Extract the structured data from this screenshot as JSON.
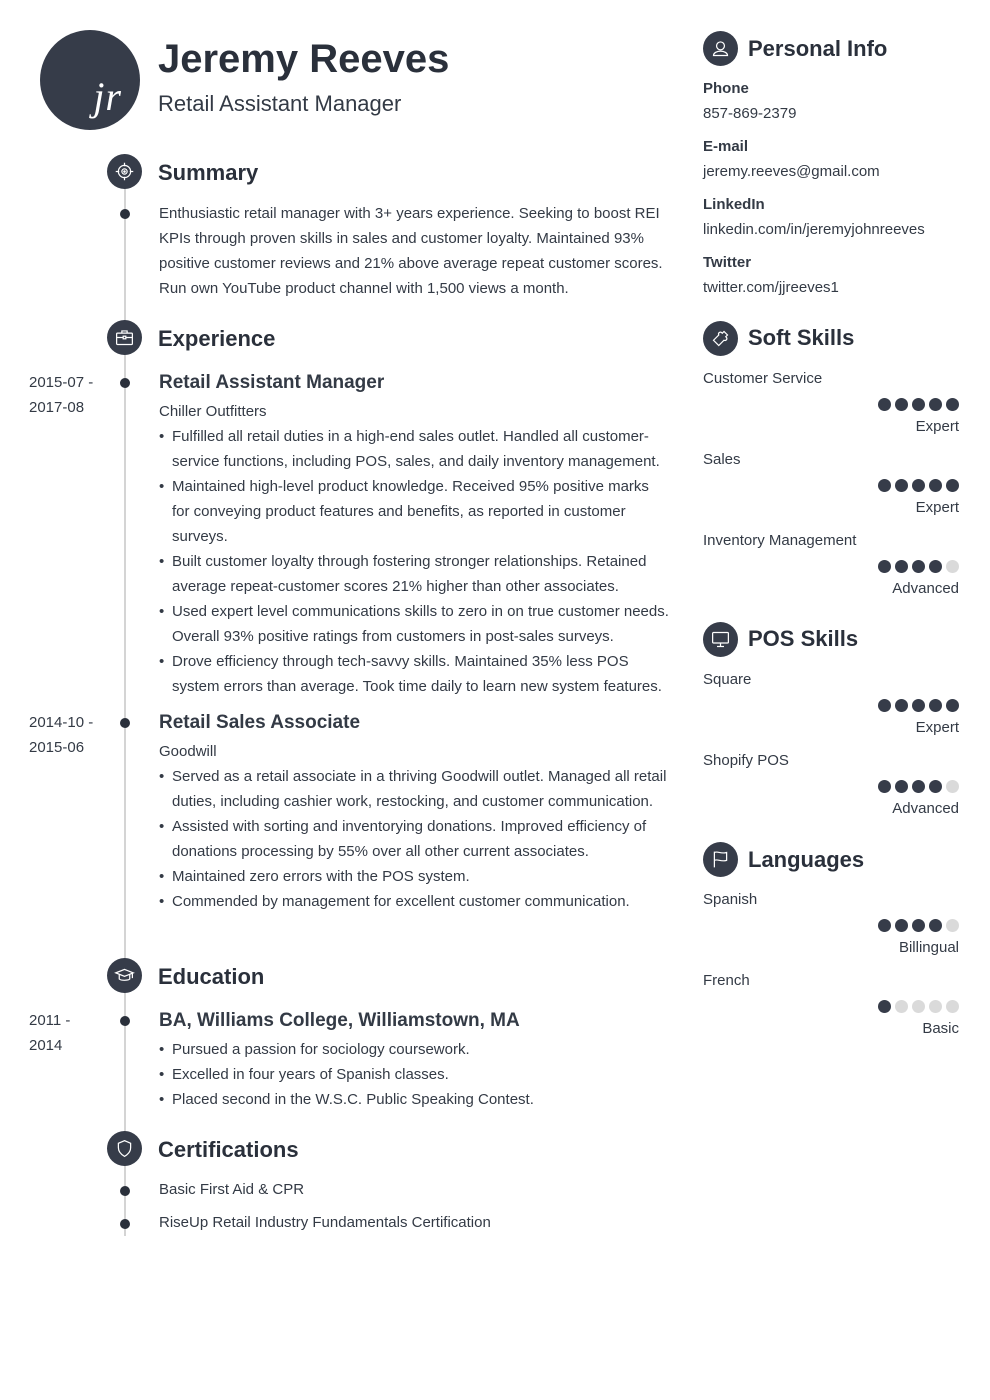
{
  "header": {
    "initials": "jr",
    "name": "Jeremy Reeves",
    "title": "Retail Assistant Manager"
  },
  "summary": {
    "heading": "Summary",
    "icon": "target-icon",
    "text": "Enthusiastic retail manager with 3+ years experience. Seeking to boost REI KPIs through proven skills in sales and customer loyalty. Maintained 93% positive customer reviews and 21% above average repeat customer scores. Run own YouTube product channel with 1,500 views a month."
  },
  "experience": {
    "heading": "Experience",
    "icon": "briefcase-icon",
    "jobs": [
      {
        "date_start": "2015-07 -",
        "date_end": "2017-08",
        "title": "Retail Assistant Manager",
        "company": "Chiller Outfitters",
        "bullets": [
          "Fulfilled all retail duties in a high-end sales outlet. Handled all customer-service functions, including POS, sales, and daily inventory management.",
          "Maintained high-level product knowledge. Received 95% positive marks for conveying product features and benefits, as reported in customer surveys.",
          "Built customer loyalty through fostering stronger relationships. Retained average repeat-customer scores 21% higher than other associates.",
          "Used expert level communications skills to zero in on true customer needs. Overall 93% positive ratings from customers in post-sales surveys.",
          "Drove efficiency through tech-savvy skills. Maintained 35% less POS system errors than average. Took time daily to learn new system features."
        ]
      },
      {
        "date_start": "2014-10 -",
        "date_end": "2015-06",
        "title": "Retail Sales Associate",
        "company": "Goodwill",
        "bullets": [
          "Served as a retail associate in a thriving Goodwill outlet. Managed all retail duties, including cashier work, restocking, and customer communication.",
          "Assisted with sorting and inventorying donations. Improved efficiency of donations processing by 55% over all other current associates.",
          "Maintained zero errors with the POS system.",
          "Commended by management for excellent customer communication."
        ]
      }
    ]
  },
  "education": {
    "heading": "Education",
    "icon": "graduation-cap-icon",
    "entries": [
      {
        "date_start": "2011 -",
        "date_end": "2014",
        "degree": "BA, Williams College, Williamstown, MA",
        "bullets": [
          "Pursued a passion for sociology coursework.",
          "Excelled in four years of Spanish classes.",
          "Placed second in the W.S.C. Public Speaking Contest."
        ]
      }
    ]
  },
  "certifications": {
    "heading": "Certifications",
    "icon": "shield-icon",
    "items": [
      "Basic First Aid & CPR",
      "RiseUp Retail Industry Fundamentals Certification"
    ]
  },
  "personal_info": {
    "heading": "Personal Info",
    "icon": "user-icon",
    "fields": [
      {
        "label": "Phone",
        "value": "857-869-2379"
      },
      {
        "label": "E-mail",
        "value": "jeremy.reeves@gmail.com"
      },
      {
        "label": "LinkedIn",
        "value": "linkedin.com/in/jeremyjohnreeves"
      },
      {
        "label": "Twitter",
        "value": "twitter.com/jjreeves1"
      }
    ]
  },
  "soft_skills": {
    "heading": "Soft Skills",
    "icon": "puzzle-icon",
    "items": [
      {
        "name": "Customer Service",
        "rating": 5,
        "max": 5,
        "level": "Expert"
      },
      {
        "name": "Sales",
        "rating": 5,
        "max": 5,
        "level": "Expert"
      },
      {
        "name": "Inventory Management",
        "rating": 4,
        "max": 5,
        "level": "Advanced"
      }
    ]
  },
  "pos_skills": {
    "heading": "POS Skills",
    "icon": "monitor-icon",
    "items": [
      {
        "name": "Square",
        "rating": 5,
        "max": 5,
        "level": "Expert"
      },
      {
        "name": "Shopify POS",
        "rating": 4,
        "max": 5,
        "level": "Advanced"
      }
    ]
  },
  "languages": {
    "heading": "Languages",
    "icon": "flag-icon",
    "items": [
      {
        "name": "Spanish",
        "rating": 4,
        "max": 5,
        "level": "Billingual"
      },
      {
        "name": "French",
        "rating": 1,
        "max": 5,
        "level": "Basic"
      }
    ]
  },
  "colors": {
    "accent": "#363c49",
    "text": "#333a45",
    "timeline": "#d4d4d4",
    "dot_off": "#dadada"
  }
}
